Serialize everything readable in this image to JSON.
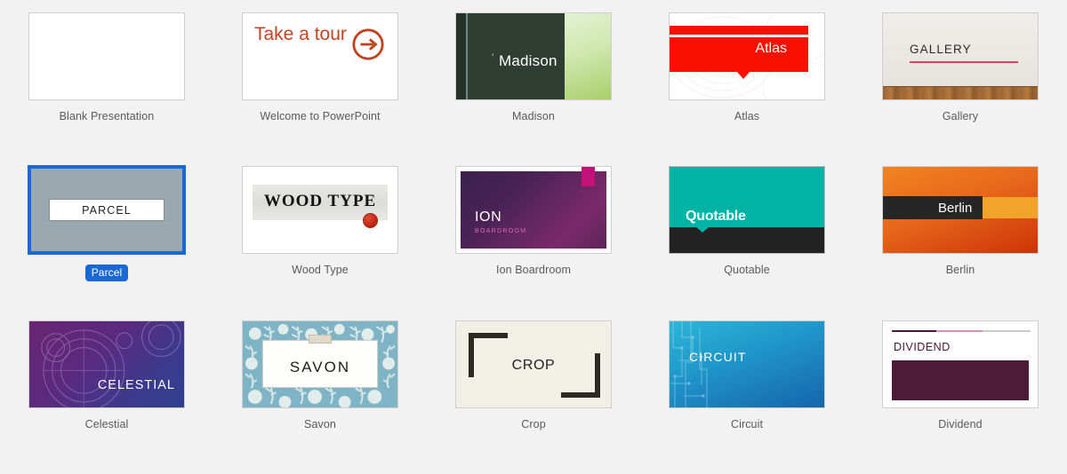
{
  "gallery": {
    "background_color": "#f2f2f2",
    "selected_template": "Parcel",
    "selection_color": "#1a68d8",
    "columns": 5,
    "rows": 3,
    "templates": [
      {
        "id": "blank-presentation",
        "caption": "Blank Presentation",
        "preview_title": "",
        "selected": false
      },
      {
        "id": "welcome-to-powerpoint",
        "caption": "Welcome to PowerPoint",
        "preview_title": "Take a tour",
        "accent_color": "#c0441f",
        "icon": "circle-arrow-right-icon",
        "selected": false
      },
      {
        "id": "madison",
        "caption": "Madison",
        "preview_title": "Madison",
        "accent_color": "#2f3d33",
        "selected": false
      },
      {
        "id": "atlas",
        "caption": "Atlas",
        "preview_title": "Atlas",
        "accent_color": "#fa0f00",
        "selected": false
      },
      {
        "id": "gallery",
        "caption": "Gallery",
        "preview_title": "GALLERY",
        "accent_color": "#d3455f",
        "selected": false
      },
      {
        "id": "parcel",
        "caption": "Parcel",
        "preview_title": "PARCEL",
        "accent_color": "#9aa9b0",
        "selected": true
      },
      {
        "id": "wood-type",
        "caption": "Wood Type",
        "preview_title": "WOOD TYPE",
        "accent_color": "#c42a15",
        "selected": false
      },
      {
        "id": "ion-boardroom",
        "caption": "Ion Boardroom",
        "preview_title": "ION",
        "preview_subtitle": "BOARDROOM",
        "accent_color": "#c2127a",
        "selected": false
      },
      {
        "id": "quotable",
        "caption": "Quotable",
        "preview_title": "Quotable",
        "accent_color": "#00b3a4",
        "selected": false
      },
      {
        "id": "berlin",
        "caption": "Berlin",
        "preview_title": "Berlin",
        "accent_color": "#e8671b",
        "selected": false
      },
      {
        "id": "celestial",
        "caption": "Celestial",
        "preview_title": "CELESTIAL",
        "accent_color": "#5a2a7e",
        "selected": false
      },
      {
        "id": "savon",
        "caption": "Savon",
        "preview_title": "SAVON",
        "accent_color": "#7fb4c6",
        "selected": false
      },
      {
        "id": "crop",
        "caption": "Crop",
        "preview_title": "CROP",
        "accent_color": "#2b2a22",
        "selected": false
      },
      {
        "id": "circuit",
        "caption": "Circuit",
        "preview_title": "CIRCUIT",
        "accent_color": "#1f94c8",
        "selected": false
      },
      {
        "id": "dividend",
        "caption": "Dividend",
        "preview_title": "DIVIDEND",
        "accent_color": "#4c1b36",
        "selected": false
      }
    ]
  }
}
